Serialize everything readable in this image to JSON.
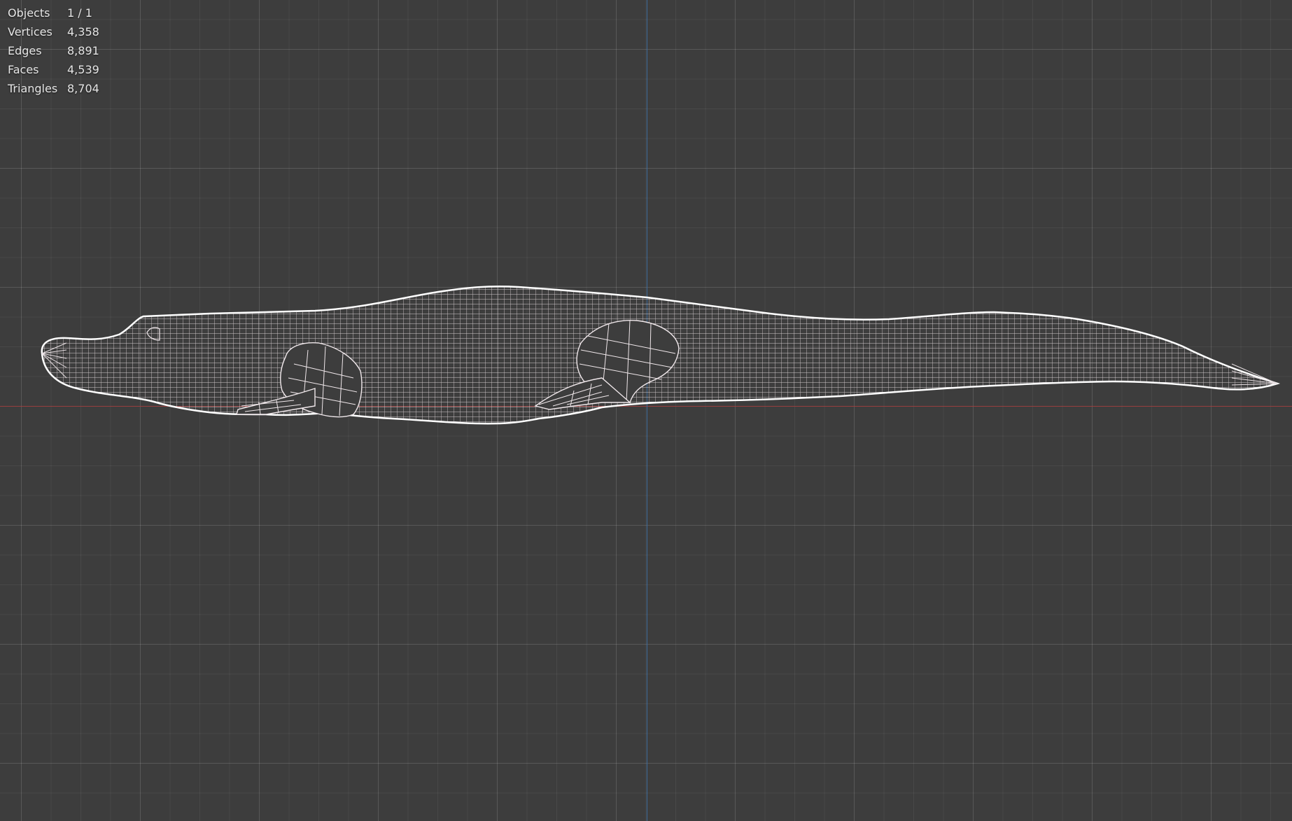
{
  "viewport": {
    "colors": {
      "background": "#3d3d3d",
      "x_axis": "#a23b3b",
      "y_axis": "#3c6ea3",
      "wireframe": "#ffffff"
    },
    "object": "crocodile-wireframe-mesh"
  },
  "stats": {
    "objects": {
      "label": "Objects",
      "value": "1 / 1"
    },
    "vertices": {
      "label": "Vertices",
      "value": "4,358"
    },
    "edges": {
      "label": "Edges",
      "value": "8,891"
    },
    "faces": {
      "label": "Faces",
      "value": "4,539"
    },
    "triangles": {
      "label": "Triangles",
      "value": "8,704"
    }
  }
}
